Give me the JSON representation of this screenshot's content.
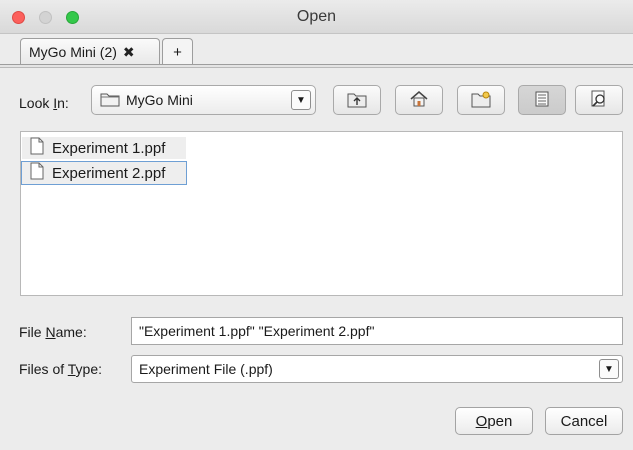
{
  "window": {
    "title": "Open"
  },
  "tabs": [
    {
      "label": "MyGo Mini (2)",
      "close_icon": "close-x-icon"
    },
    {
      "label": "+"
    }
  ],
  "look_in": {
    "label_pre": "Look ",
    "label_mnemonic": "I",
    "label_post": "n:",
    "value": "MyGo Mini",
    "icon": "folder-icon"
  },
  "toolbar": [
    {
      "name": "up-one-level",
      "icon": "folder-up-icon"
    },
    {
      "name": "home",
      "icon": "home-icon"
    },
    {
      "name": "new-folder",
      "icon": "new-folder-icon"
    },
    {
      "name": "list-view",
      "icon": "list-view-icon"
    },
    {
      "name": "details-view",
      "icon": "details-view-icon"
    }
  ],
  "files": [
    {
      "name": "Experiment 1.ppf",
      "icon": "document-icon"
    },
    {
      "name": "Experiment 2.ppf",
      "icon": "document-icon"
    }
  ],
  "file_name": {
    "label_pre": "File ",
    "label_mnemonic": "N",
    "label_post": "ame:",
    "value": "\"Experiment 1.ppf\" \"Experiment 2.ppf\""
  },
  "files_of_type": {
    "label_pre": "Files of ",
    "label_mnemonic": "T",
    "label_post": "ype:",
    "value": "Experiment File (.ppf)"
  },
  "buttons": {
    "open_mnemonic": "O",
    "open_rest": "pen",
    "cancel": "Cancel"
  }
}
